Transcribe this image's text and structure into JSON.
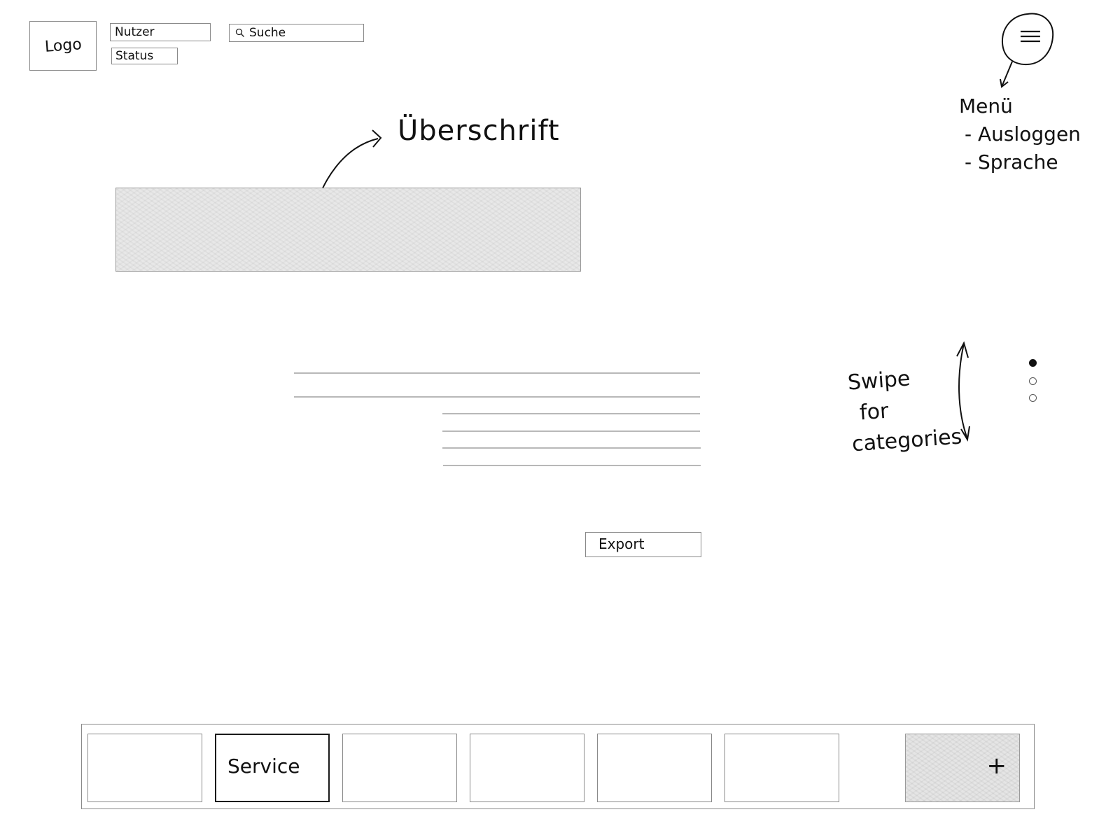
{
  "header": {
    "logo_label": "Logo",
    "user_field_value": "Nutzer",
    "status_field_value": "Status",
    "search_field_value": "Suche"
  },
  "icons": {
    "search": "search-icon",
    "menu": "hamburger-menu-icon",
    "add": "plus-icon"
  },
  "menu_notes": {
    "title": "Menü",
    "items": [
      "- Ausloggen",
      "- Sprache"
    ]
  },
  "heading_note": "Überschrift",
  "export_label": "Export",
  "swipe_note": [
    "Swipe",
    "for",
    "categories"
  ],
  "pager": {
    "count": 3,
    "active_index": 0
  },
  "bottom_bar": {
    "tiles": [
      "",
      "Service",
      "",
      "",
      "",
      ""
    ],
    "active_tile_index": 1,
    "add_label": "+"
  }
}
